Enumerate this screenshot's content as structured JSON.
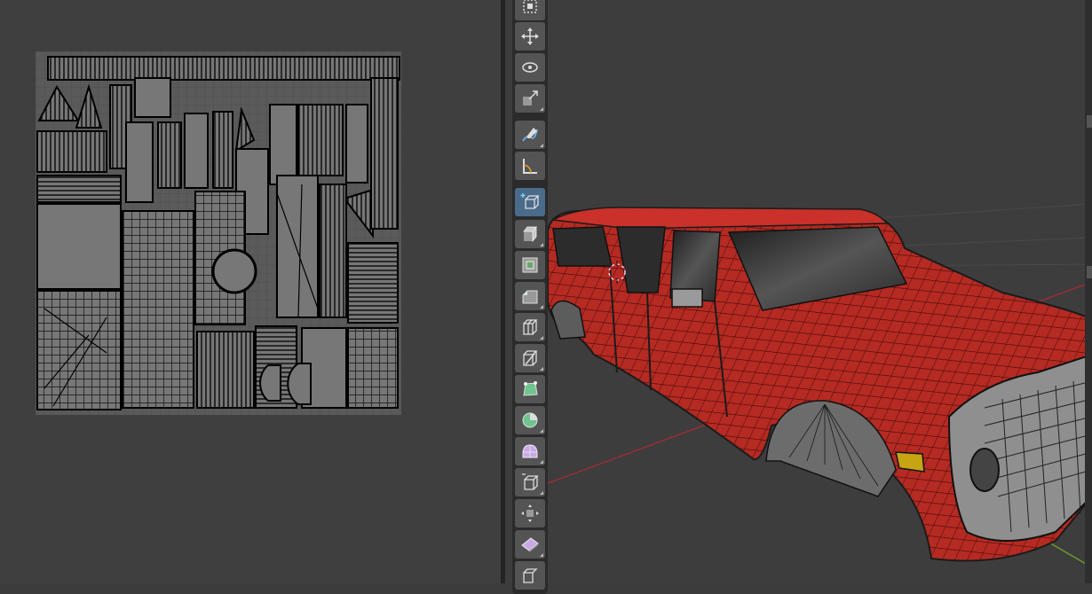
{
  "uv_editor": {
    "background": "#3f3f3f",
    "wire_color": "#000000",
    "island_fill": "#6d6d6d"
  },
  "viewport": {
    "background": "#3d3d3d",
    "model_color": "#b52a22",
    "glass_color": "#2c2c2c",
    "trim_color": "#9a9a9a",
    "x_axis_color": "#9a2b38",
    "y_axis_color": "#6a9a2a"
  },
  "toolbar": {
    "tools": [
      {
        "name": "select-box",
        "icon": "select-box-icon"
      },
      {
        "name": "move",
        "icon": "move-icon"
      },
      {
        "name": "rotate",
        "icon": "rotate-icon"
      },
      {
        "name": "scale",
        "icon": "scale-icon"
      },
      {
        "name": "annotate",
        "icon": "annotate-icon"
      },
      {
        "name": "measure",
        "icon": "measure-icon"
      },
      {
        "name": "add-cube",
        "icon": "add-cube-icon"
      },
      {
        "name": "extrude-region",
        "icon": "extrude-region-icon"
      },
      {
        "name": "inset-faces",
        "icon": "inset-faces-icon"
      },
      {
        "name": "bevel",
        "icon": "bevel-icon"
      },
      {
        "name": "loop-cut",
        "icon": "loop-cut-icon"
      },
      {
        "name": "knife",
        "icon": "knife-icon"
      },
      {
        "name": "poly-build",
        "icon": "poly-build-icon"
      },
      {
        "name": "spin",
        "icon": "spin-icon"
      },
      {
        "name": "smooth",
        "icon": "smooth-icon"
      },
      {
        "name": "edge-slide",
        "icon": "edge-slide-icon"
      },
      {
        "name": "shrink-fatten",
        "icon": "shrink-fatten-icon"
      },
      {
        "name": "shear",
        "icon": "shear-icon"
      },
      {
        "name": "rip-region",
        "icon": "rip-region-icon"
      }
    ]
  }
}
